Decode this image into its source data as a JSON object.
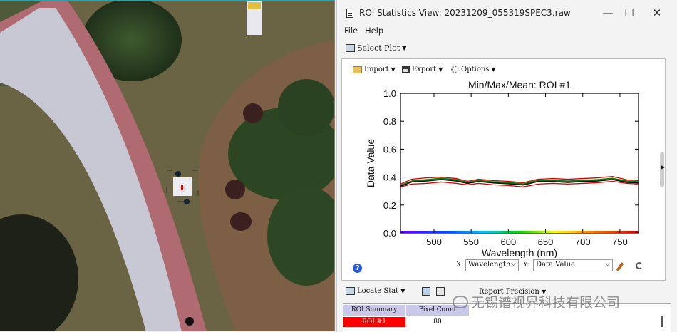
{
  "window": {
    "title": "ROI Statistics View: 20231209_055319SPEC3.raw",
    "controls": {
      "minimize": "—",
      "maximize": "☐",
      "close": "✕"
    }
  },
  "menu": {
    "file": "File",
    "help": "Help"
  },
  "toolbar": {
    "select_plot": "Select Plot"
  },
  "plot_toolbar": {
    "import": "Import",
    "export": "Export",
    "options": "Options"
  },
  "chart_data": {
    "type": "line",
    "title": "Min/Max/Mean: ROI #1",
    "xlabel": "Wavelength (nm)",
    "ylabel": "Data Value",
    "xlim": [
      455,
      775
    ],
    "ylim": [
      0.0,
      1.0
    ],
    "x_ticks": [
      500,
      550,
      600,
      650,
      700,
      750
    ],
    "y_ticks": [
      "0.0",
      "0.2",
      "0.4",
      "0.6",
      "0.8",
      "1.0"
    ],
    "x": [
      455,
      470,
      490,
      510,
      530,
      545,
      560,
      580,
      600,
      620,
      640,
      660,
      680,
      700,
      720,
      740,
      760,
      775
    ],
    "series": [
      {
        "role": "max",
        "color": "#e00000",
        "values": [
          0.35,
          0.385,
          0.395,
          0.4,
          0.39,
          0.37,
          0.385,
          0.375,
          0.37,
          0.36,
          0.385,
          0.39,
          0.385,
          0.39,
          0.395,
          0.405,
          0.38,
          0.375
        ]
      },
      {
        "role": "mean",
        "color": "#008000",
        "values": [
          0.34,
          0.37,
          0.38,
          0.39,
          0.38,
          0.36,
          0.375,
          0.365,
          0.36,
          0.35,
          0.375,
          0.375,
          0.37,
          0.375,
          0.38,
          0.39,
          0.37,
          0.365
        ]
      },
      {
        "role": "stdev",
        "color": "#000000",
        "values": [
          0.335,
          0.365,
          0.372,
          0.382,
          0.372,
          0.355,
          0.368,
          0.358,
          0.352,
          0.343,
          0.368,
          0.368,
          0.362,
          0.368,
          0.372,
          0.382,
          0.362,
          0.358
        ]
      },
      {
        "role": "min",
        "color": "#e00000",
        "values": [
          0.33,
          0.35,
          0.355,
          0.365,
          0.355,
          0.345,
          0.355,
          0.345,
          0.34,
          0.33,
          0.35,
          0.355,
          0.35,
          0.355,
          0.36,
          0.37,
          0.355,
          0.35
        ]
      }
    ],
    "grid": false
  },
  "axis_selectors": {
    "x_label": "X:",
    "x_value": "Wavelength",
    "y_label": "Y:",
    "y_value": "Data Value"
  },
  "stats_toolbar": {
    "locate_stat": "Locate Stat",
    "report_precision": "Report Precision"
  },
  "table": {
    "headers": [
      "ROI Summary",
      "Pixel Count"
    ],
    "rows": [
      {
        "roi": "ROI #1",
        "pixel_count": "80",
        "color": "#ff0000"
      }
    ]
  },
  "watermark": {
    "text": "无锡谱视界科技有限公司"
  }
}
